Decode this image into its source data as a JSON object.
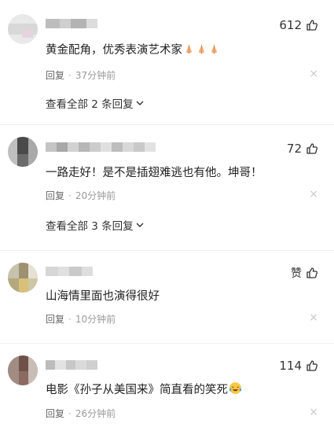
{
  "comments": [
    {
      "likes": "612",
      "content": "黄金配角，优秀表演艺术家",
      "emoji": [
        "pray-emoji",
        "pray-emoji",
        "pray-emoji"
      ],
      "reply": "回复",
      "time": "37分钟前",
      "view_replies": "查看全部 2 条回复"
    },
    {
      "likes": "72",
      "content": "一路走好！是不是插翅难逃也有他。坤哥！",
      "reply": "回复",
      "time": "20分钟前",
      "view_replies": "查看全部 3 条回复"
    },
    {
      "likes": "赞",
      "content": "山海情里面也演得很好",
      "reply": "回复",
      "time": "10分钟前"
    },
    {
      "likes": "114",
      "content": "电影《孙子从美国来》简直看的笑死",
      "emoji": [
        "laugh-cry-emoji"
      ],
      "reply": "回复",
      "time": "26分钟前"
    }
  ],
  "close_glyph": "×",
  "dot": "·",
  "colors": {
    "meta": "#9a9a9a",
    "text": "#222222",
    "divider": "#f0f0f0"
  }
}
